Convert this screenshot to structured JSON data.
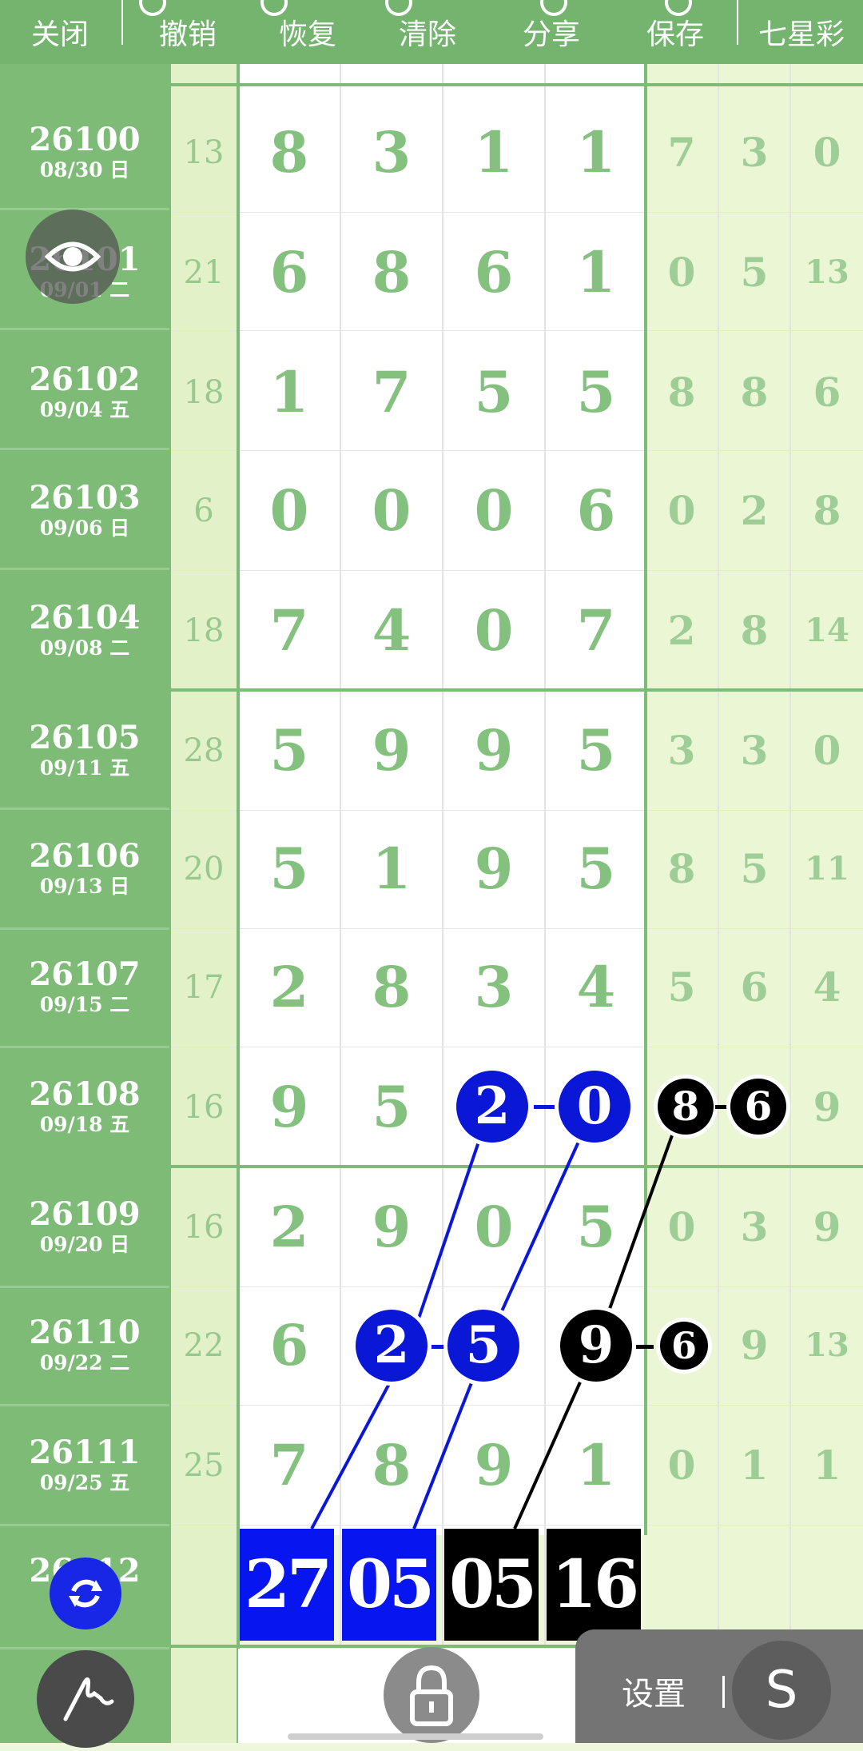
{
  "toolbar": {
    "close": "关闭",
    "undo": "撤销",
    "redo": "恢复",
    "clear": "清除",
    "share": "分享",
    "save": "保存",
    "game": "七星彩"
  },
  "rows": [
    {
      "issue": "26100",
      "date": "08/30 日",
      "sum": "13",
      "digits": [
        "8",
        "3",
        "1",
        "1"
      ],
      "right": [
        "7",
        "3",
        "0"
      ]
    },
    {
      "issue": "26101",
      "date": "09/01 二",
      "sum": "21",
      "digits": [
        "6",
        "8",
        "6",
        "1"
      ],
      "right": [
        "0",
        "5",
        "13"
      ]
    },
    {
      "issue": "26102",
      "date": "09/04 五",
      "sum": "18",
      "digits": [
        "1",
        "7",
        "5",
        "5"
      ],
      "right": [
        "8",
        "8",
        "6"
      ]
    },
    {
      "issue": "26103",
      "date": "09/06 日",
      "sum": "6",
      "digits": [
        "0",
        "0",
        "0",
        "6"
      ],
      "right": [
        "0",
        "2",
        "8"
      ]
    },
    {
      "issue": "26104",
      "date": "09/08 二",
      "sum": "18",
      "digits": [
        "7",
        "4",
        "0",
        "7"
      ],
      "right": [
        "2",
        "8",
        "14"
      ]
    },
    {
      "issue": "26105",
      "date": "09/11 五",
      "sum": "28",
      "digits": [
        "5",
        "9",
        "9",
        "5"
      ],
      "right": [
        "3",
        "3",
        "0"
      ]
    },
    {
      "issue": "26106",
      "date": "09/13 日",
      "sum": "20",
      "digits": [
        "5",
        "1",
        "9",
        "5"
      ],
      "right": [
        "8",
        "5",
        "11"
      ]
    },
    {
      "issue": "26107",
      "date": "09/15 二",
      "sum": "17",
      "digits": [
        "2",
        "8",
        "3",
        "4"
      ],
      "right": [
        "5",
        "6",
        "4"
      ]
    },
    {
      "issue": "26108",
      "date": "09/18 五",
      "sum": "16",
      "digits": [
        "9",
        "5",
        "2",
        "0"
      ],
      "right": [
        "8",
        "6",
        "9"
      ]
    },
    {
      "issue": "26109",
      "date": "09/20 日",
      "sum": "16",
      "digits": [
        "2",
        "9",
        "0",
        "5"
      ],
      "right": [
        "0",
        "3",
        "9"
      ]
    },
    {
      "issue": "26110",
      "date": "09/22 二",
      "sum": "22",
      "digits": [
        "6",
        "2",
        "5",
        "9"
      ],
      "right": [
        "6",
        "9",
        "13"
      ]
    },
    {
      "issue": "26111",
      "date": "09/25 五",
      "sum": "25",
      "digits": [
        "7",
        "8",
        "9",
        "1"
      ],
      "right": [
        "0",
        "1",
        "1"
      ]
    }
  ],
  "next_issue": "26112",
  "results": [
    "27",
    "05",
    "05",
    "16"
  ],
  "settings": {
    "label": "设置",
    "icon": "S"
  },
  "icons": [
    "eye-icon",
    "refresh-icon",
    "pen-icon",
    "lock-icon"
  ],
  "colors": {
    "green": "#7dbb77",
    "blue": "#0a17d7",
    "black": "#000000"
  }
}
